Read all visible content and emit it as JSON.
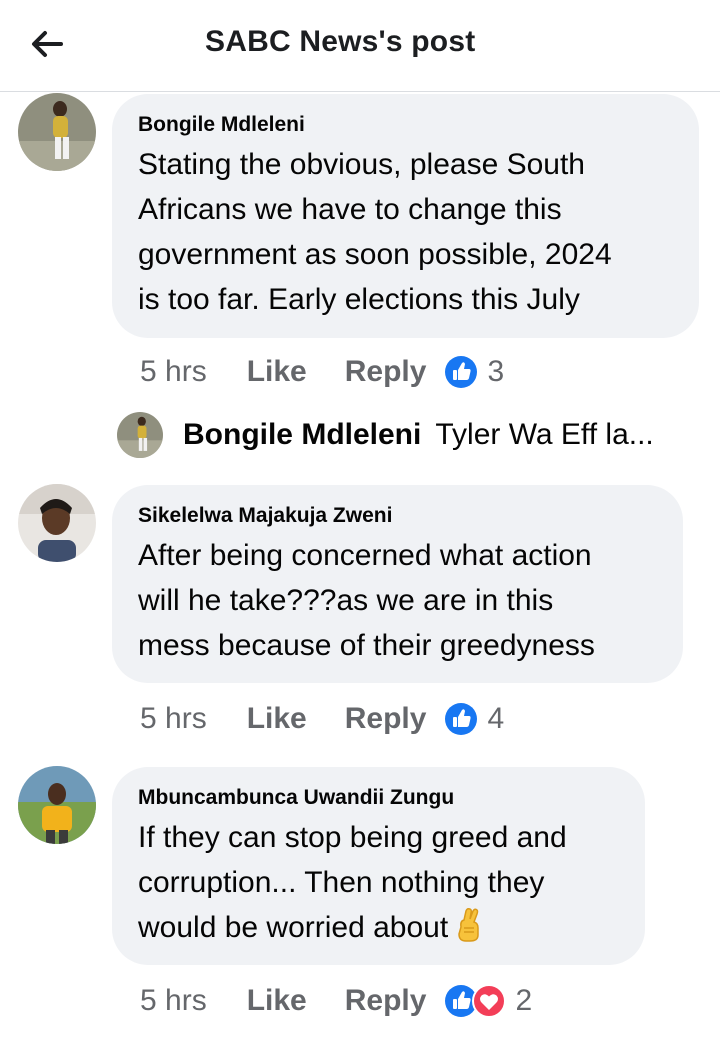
{
  "header": {
    "title": "SABC News's post",
    "back_icon": "back-arrow-icon"
  },
  "comments": [
    {
      "author": "Bongile Mdleleni",
      "lines": [
        "Stating the obvious, please South",
        "Africans we have to change this",
        "government as soon possible, 2024",
        "is too far. Early elections this July"
      ],
      "time": "5 hrs",
      "like_label": "Like",
      "reply_label": "Reply",
      "reaction_count": "3",
      "reactions": [
        "like-icon"
      ]
    },
    {
      "author": "Sikelelwa Majakuja Zweni",
      "lines": [
        "After being concerned what action",
        "will he take???as we are in this",
        "mess because of their greedyness"
      ],
      "time": "5 hrs",
      "like_label": "Like",
      "reply_label": "Reply",
      "reaction_count": "4",
      "reactions": [
        "like-icon"
      ]
    },
    {
      "author": "Mbuncambunca Uwandii Zungu",
      "lines": [
        "If they can stop being greed and",
        "corruption... Then  nothing they",
        "would be worried about"
      ],
      "emoji": "crossed-fingers-icon",
      "time": "5 hrs",
      "like_label": "Like",
      "reply_label": "Reply",
      "reaction_count": "2",
      "reactions": [
        "like-icon",
        "love-icon"
      ]
    }
  ],
  "reply_preview": {
    "author": "Bongile Mdleleni",
    "text": "Tyler Wa Eff la..."
  },
  "colors": {
    "bubble": "#f0f2f5",
    "secondary_text": "#65676b",
    "like_blue": "#1877f2",
    "love_red": "#f33e58"
  }
}
